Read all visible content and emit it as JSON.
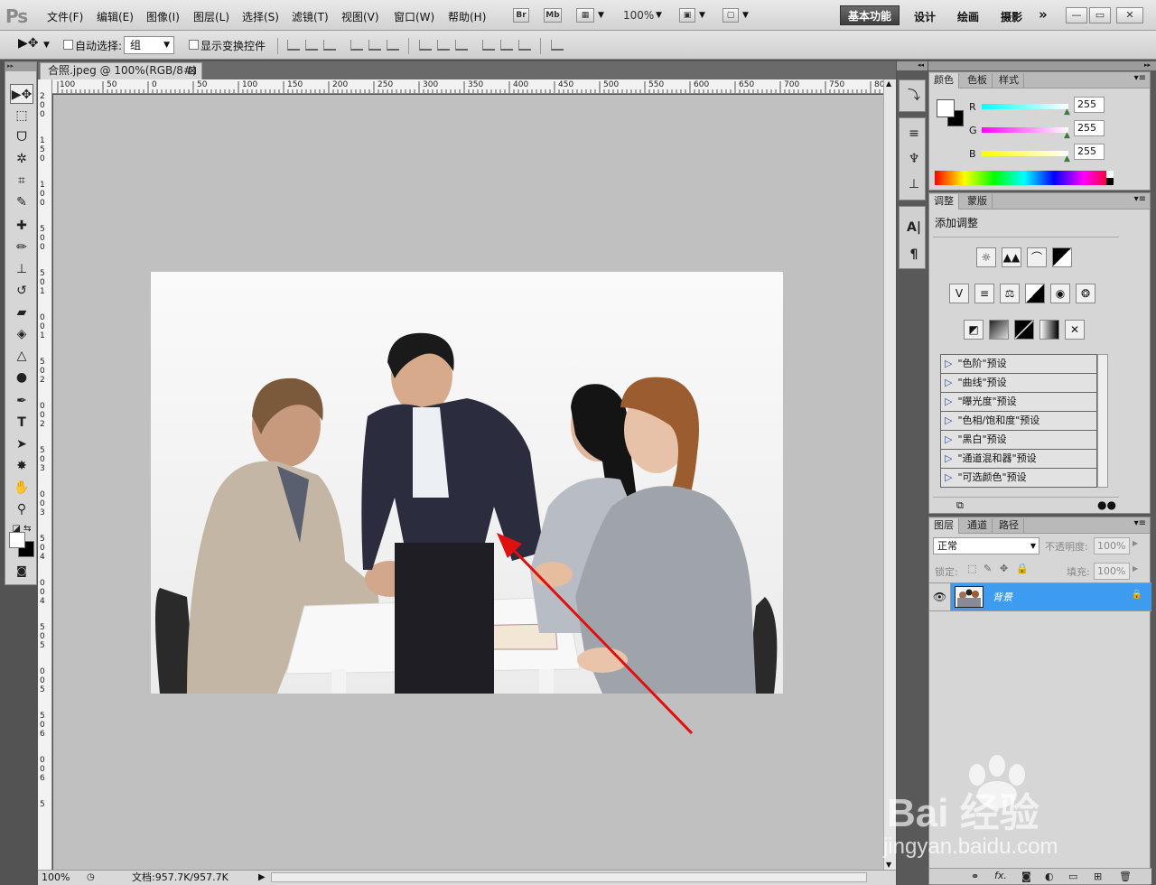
{
  "app": {
    "logo": "Ps"
  },
  "menu": [
    "文件(F)",
    "编辑(E)",
    "图像(I)",
    "图层(L)",
    "选择(S)",
    "滤镜(T)",
    "视图(V)",
    "窗口(W)",
    "帮助(H)"
  ],
  "menu_buttons": {
    "br": "Br",
    "mb": "Mb",
    "zoom": "100%"
  },
  "workspaces": {
    "active": "基本功能",
    "design": "设计",
    "paint": "绘画",
    "photo": "摄影",
    "more": "»"
  },
  "window_controls": {
    "minimize": "—",
    "restore": "▭",
    "close": "✕"
  },
  "options": {
    "auto_select_label": "自动选择:",
    "auto_select_value": "组",
    "show_transform_label": "显示变换控件"
  },
  "document": {
    "tab_title": "合照.jpeg @ 100%(RGB/8#)",
    "close_glyph": "⊠",
    "hruler_labels": [
      "100",
      "50",
      "0",
      "50",
      "100",
      "150",
      "200",
      "250",
      "300",
      "350",
      "400",
      "450",
      "500",
      "550",
      "600",
      "650",
      "700",
      "750",
      "80"
    ],
    "vruler_labels": [
      "2",
      "0",
      "0",
      "1",
      "5",
      "0",
      "1",
      "0",
      "0",
      "5",
      "0",
      "0",
      "5",
      "0",
      "1",
      "0",
      "0",
      "1",
      "5",
      "0",
      "2",
      "0",
      "0",
      "2",
      "5",
      "0",
      "3",
      "0",
      "0",
      "3",
      "5",
      "0",
      "4",
      "0",
      "0",
      "4",
      "5",
      "0",
      "5",
      "0",
      "0",
      "5",
      "5",
      "0",
      "6",
      "0",
      "0",
      "6",
      "5"
    ]
  },
  "status": {
    "zoom": "100%",
    "doc_info": "文档:957.7K/957.7K"
  },
  "color_panel": {
    "tabs": [
      "颜色",
      "色板",
      "样式"
    ],
    "r_label": "R",
    "g_label": "G",
    "b_label": "B",
    "r": "255",
    "g": "255",
    "b": "255"
  },
  "adjust_panel": {
    "tabs": [
      "调整",
      "蒙版"
    ],
    "title": "添加调整",
    "presets": [
      "\"色阶\"预设",
      "\"曲线\"预设",
      "\"曝光度\"预设",
      "\"色相/饱和度\"预设",
      "\"黑白\"预设",
      "\"通道混和器\"预设",
      "\"可选颜色\"预设"
    ]
  },
  "layers_panel": {
    "tabs": [
      "图层",
      "通道",
      "路径"
    ],
    "blend_mode": "正常",
    "opacity_label": "不透明度:",
    "opacity": "100%",
    "lock_label": "锁定:",
    "fill_label": "填充:",
    "fill": "100%",
    "layer_name": "背景"
  },
  "watermark": {
    "brand": "Bai 经验",
    "site": "jingyan.baidu.com"
  },
  "colors": {
    "accent_layer": "#3d9bf0",
    "arrow": "#e01010",
    "canvas_bg": "#c0c0c0"
  }
}
